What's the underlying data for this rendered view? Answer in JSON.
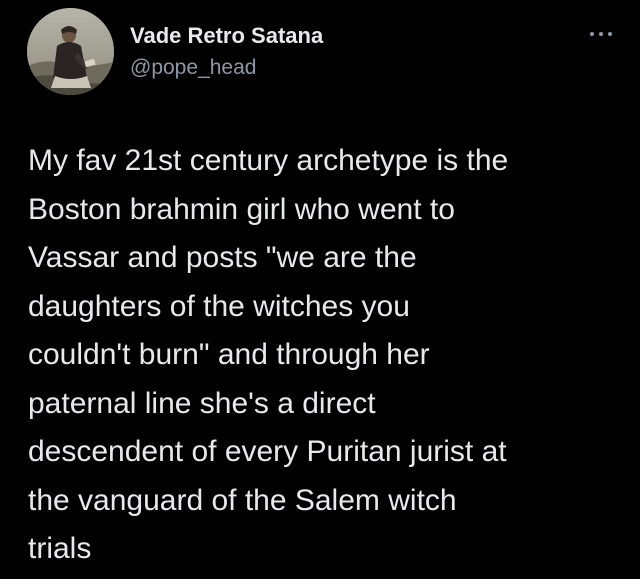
{
  "author": {
    "display_name": "Vade Retro Satana",
    "handle": "@pope_head",
    "avatar_icon": "avatar-portrait"
  },
  "menu": {
    "icon": "more-options-icon"
  },
  "tweet": {
    "lines": [
      "My fav 21st century archetype is the",
      "Boston brahmin girl who went to",
      "Vassar and posts \"we are the",
      "daughters of the witches you",
      "couldn't burn\" and through her",
      "paternal line she's a direct",
      "descendent of every Puritan jurist at",
      "the vanguard of the Salem witch",
      "trials"
    ]
  },
  "colors": {
    "background": "#000000",
    "text_primary": "#e7e9ea",
    "text_secondary": "#8b98a5"
  }
}
